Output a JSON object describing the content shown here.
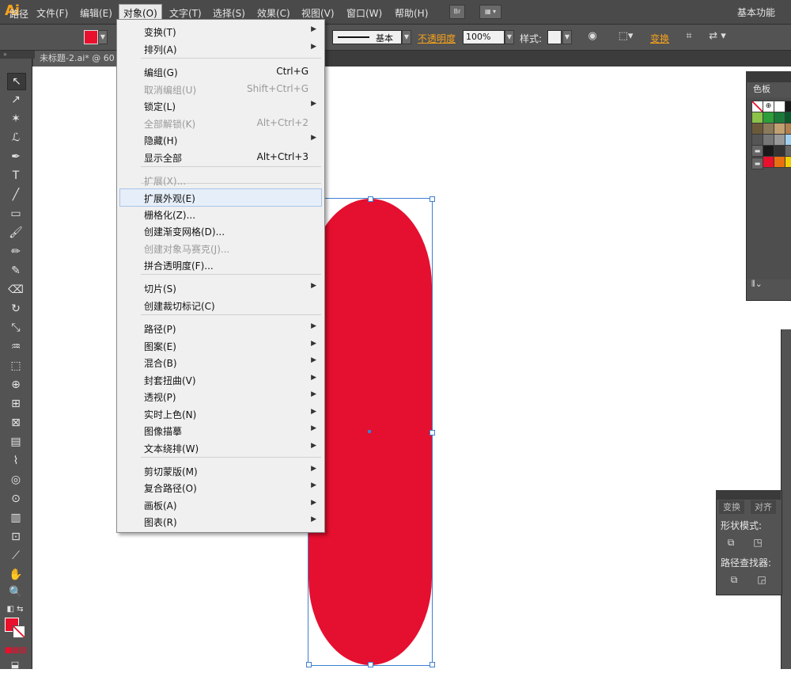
{
  "app": {
    "logo": "Ai",
    "workspace": "基本功能"
  },
  "menubar": {
    "items": [
      "文件(F)",
      "编辑(E)",
      "对象(O)",
      "文字(T)",
      "选择(S)",
      "效果(C)",
      "视图(V)",
      "窗口(W)",
      "帮助(H)"
    ],
    "active": "对象(O)",
    "bridge_label": "Br"
  },
  "controlbar": {
    "label": "路径",
    "stroke_style": "基本",
    "opacity_label": "不透明度",
    "opacity_value": "100%",
    "style_label": "样式:",
    "transform_label": "变换"
  },
  "document_tab": {
    "label": "未标题-2.ai* @ 60"
  },
  "dropdown": {
    "items": [
      {
        "label": "变换(T)",
        "shortcut": "",
        "submenu": true,
        "enabled": true
      },
      {
        "label": "排列(A)",
        "shortcut": "",
        "submenu": true,
        "enabled": true
      },
      {
        "label": "编组(G)",
        "shortcut": "Ctrl+G",
        "submenu": false,
        "enabled": true
      },
      {
        "label": "取消编组(U)",
        "shortcut": "Shift+Ctrl+G",
        "submenu": false,
        "enabled": false
      },
      {
        "label": "锁定(L)",
        "shortcut": "",
        "submenu": true,
        "enabled": true
      },
      {
        "label": "全部解锁(K)",
        "shortcut": "Alt+Ctrl+2",
        "submenu": false,
        "enabled": false
      },
      {
        "label": "隐藏(H)",
        "shortcut": "",
        "submenu": true,
        "enabled": true
      },
      {
        "label": "显示全部",
        "shortcut": "Alt+Ctrl+3",
        "submenu": false,
        "enabled": true
      },
      {
        "label": "扩展(X)...",
        "shortcut": "",
        "submenu": false,
        "enabled": false
      },
      {
        "label": "扩展外观(E)",
        "shortcut": "",
        "submenu": false,
        "enabled": true,
        "highlighted": true
      },
      {
        "label": "栅格化(Z)...",
        "shortcut": "",
        "submenu": false,
        "enabled": true
      },
      {
        "label": "创建渐变网格(D)...",
        "shortcut": "",
        "submenu": false,
        "enabled": true
      },
      {
        "label": "创建对象马赛克(J)...",
        "shortcut": "",
        "submenu": false,
        "enabled": false
      },
      {
        "label": "拼合透明度(F)...",
        "shortcut": "",
        "submenu": false,
        "enabled": true
      },
      {
        "label": "切片(S)",
        "shortcut": "",
        "submenu": true,
        "enabled": true
      },
      {
        "label": "创建裁切标记(C)",
        "shortcut": "",
        "submenu": false,
        "enabled": true
      },
      {
        "label": "路径(P)",
        "shortcut": "",
        "submenu": true,
        "enabled": true
      },
      {
        "label": "图案(E)",
        "shortcut": "",
        "submenu": true,
        "enabled": true
      },
      {
        "label": "混合(B)",
        "shortcut": "",
        "submenu": true,
        "enabled": true
      },
      {
        "label": "封套扭曲(V)",
        "shortcut": "",
        "submenu": true,
        "enabled": true
      },
      {
        "label": "透视(P)",
        "shortcut": "",
        "submenu": true,
        "enabled": true
      },
      {
        "label": "实时上色(N)",
        "shortcut": "",
        "submenu": true,
        "enabled": true
      },
      {
        "label": "图像描摹",
        "shortcut": "",
        "submenu": true,
        "enabled": true
      },
      {
        "label": "文本绕排(W)",
        "shortcut": "",
        "submenu": true,
        "enabled": true
      },
      {
        "label": "剪切蒙版(M)",
        "shortcut": "",
        "submenu": true,
        "enabled": true
      },
      {
        "label": "复合路径(O)",
        "shortcut": "",
        "submenu": true,
        "enabled": true
      },
      {
        "label": "画板(A)",
        "shortcut": "",
        "submenu": true,
        "enabled": true
      },
      {
        "label": "图表(R)",
        "shortcut": "",
        "submenu": true,
        "enabled": true
      }
    ]
  },
  "swatches_panel": {
    "title": "色板"
  },
  "pathfinder_panel": {
    "tabs": [
      "变换",
      "对齐"
    ],
    "shape_modes_label": "形状模式:",
    "pathfinders_label": "路径查找器:"
  },
  "colors": {
    "accent": "#f7a21b",
    "shape_fill": "#e50f2f",
    "selection": "#3e7fd4",
    "swatches": [
      "#ffffff",
      "#ffffff",
      "#ffffff",
      "#1a1a1a",
      "#8bc34a",
      "#2e9e3a",
      "#1b7a3a",
      "#0a5a2a",
      "#6b5a3a",
      "#8a7a5a",
      "#c0a070",
      "#b08050",
      "#555555",
      "#777777",
      "#999999",
      "#9fd0f0",
      "#444444",
      "#1a1a1a",
      "#333333",
      "#666666",
      "#666666",
      "#e8102c",
      "#e87010",
      "#f0d000"
    ]
  }
}
